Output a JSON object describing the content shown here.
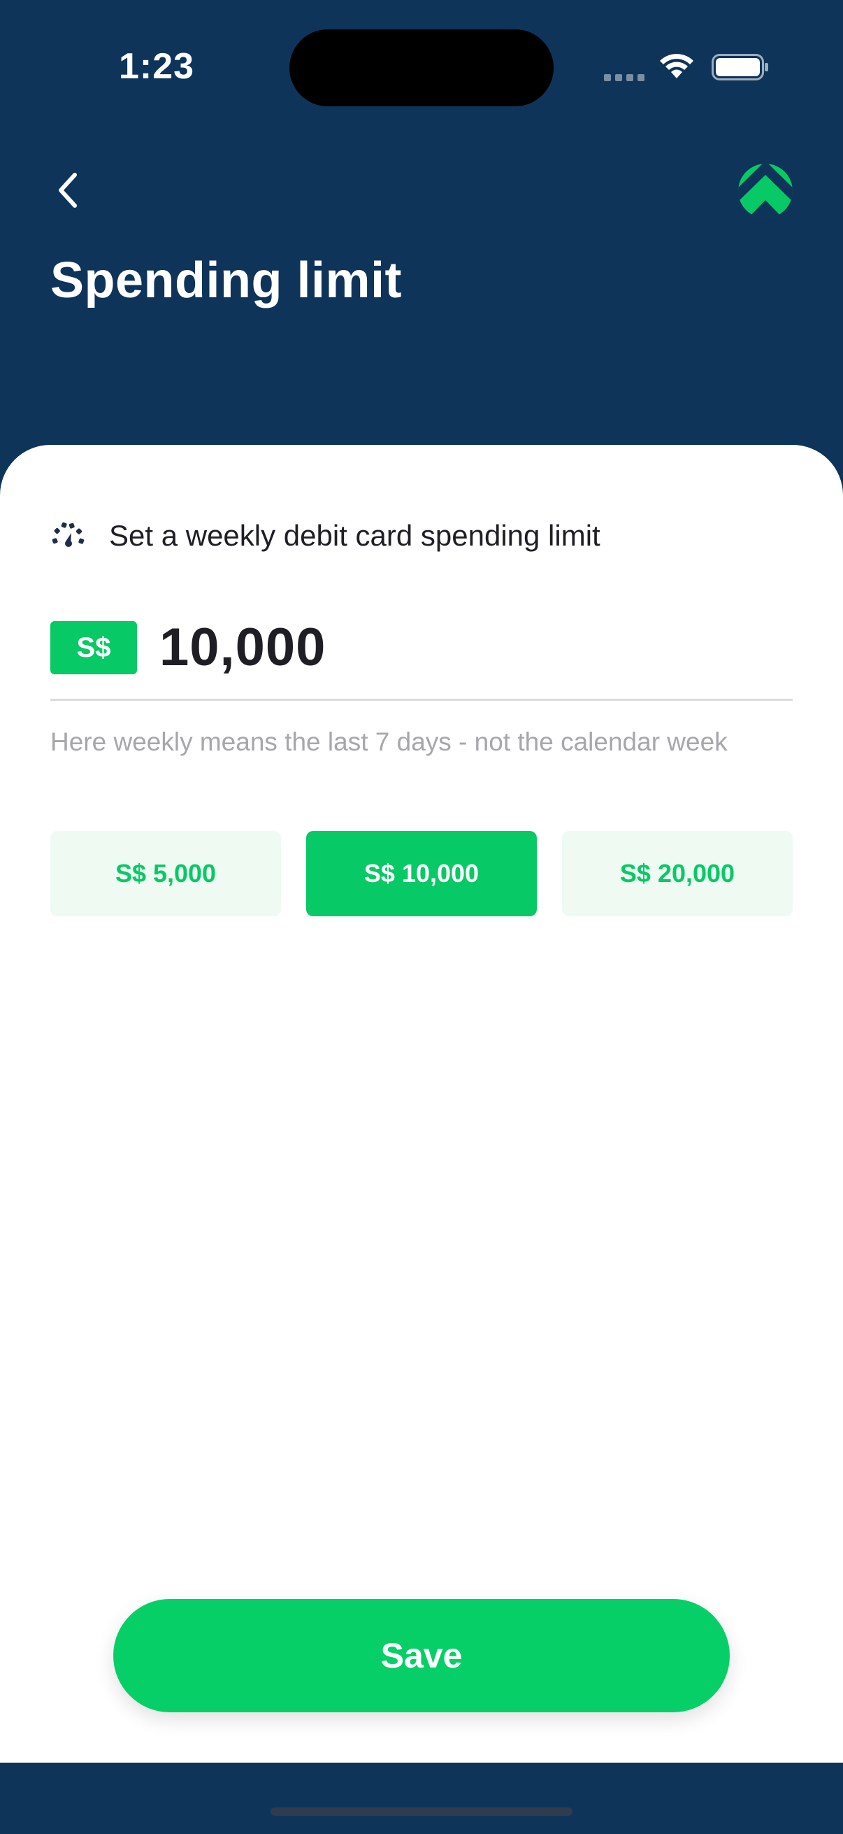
{
  "status_bar": {
    "time": "1:23",
    "wifi_icon": "wifi-icon",
    "battery_icon": "battery-icon"
  },
  "header": {
    "back_icon": "chevron-left-icon",
    "logo_icon": "brand-logo-icon",
    "title": "Spending limit"
  },
  "limit_form": {
    "intro_icon": "gauge-icon",
    "intro_text": "Set a weekly debit card spending limit",
    "currency": "S$",
    "amount": "10,000",
    "hint": "Here weekly means the last 7 days - not the calendar week",
    "presets": [
      {
        "label": "S$ 5,000",
        "selected": false
      },
      {
        "label": "S$ 10,000",
        "selected": true
      },
      {
        "label": "S$ 20,000",
        "selected": false
      }
    ]
  },
  "actions": {
    "save_label": "Save"
  },
  "colors": {
    "header_background": "#0e3459",
    "accent_green": "#07c965",
    "preset_background": "#eefaf2",
    "text_primary": "#1e1e24",
    "text_hint": "#a6a6ab"
  }
}
